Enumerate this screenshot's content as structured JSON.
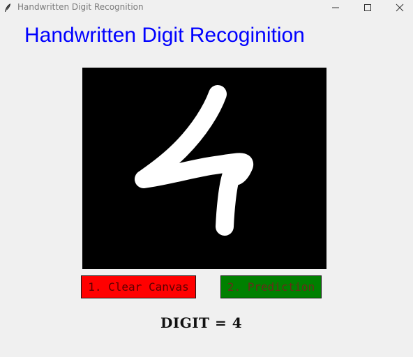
{
  "window": {
    "title": "Handwritten Digit Recognition",
    "app_icon": "feather-icon",
    "controls": {
      "minimize_icon": "minimize-icon",
      "maximize_icon": "maximize-icon",
      "close_icon": "close-icon"
    }
  },
  "app": {
    "heading": "Handwritten Digit Recoginition",
    "heading_color": "#0000ff",
    "canvas": {
      "background": "#000000",
      "stroke_color": "#ffffff"
    },
    "buttons": {
      "clear_label": "1. Clear Canvas",
      "clear_color": "#ff0000",
      "predict_label": "2. Prediction",
      "predict_color": "#008000"
    },
    "result_text": "DIGIT = 4"
  }
}
